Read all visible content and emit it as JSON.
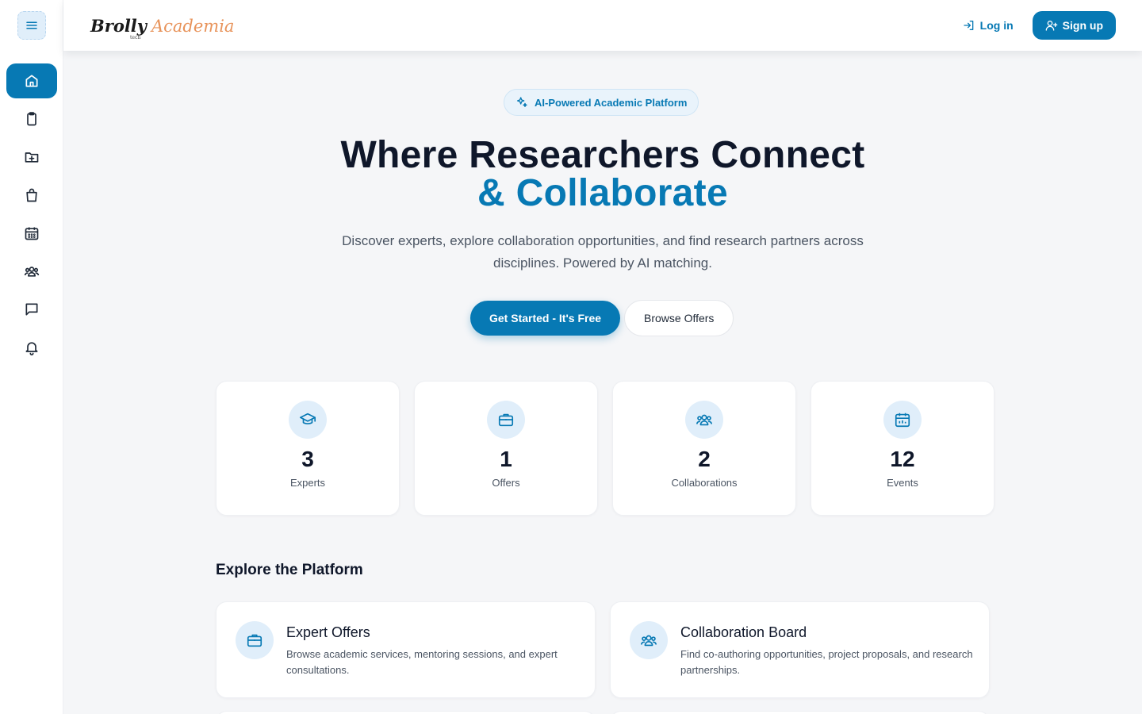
{
  "header": {
    "logo_word1": "Brolly",
    "logo_word2": "Academia",
    "logo_tm": "tech",
    "login_label": "Log in",
    "signup_label": "Sign up"
  },
  "sidebar": {
    "items": [
      {
        "icon": "home-icon",
        "active": true
      },
      {
        "icon": "clipboard-icon"
      },
      {
        "icon": "folder-plus-icon"
      },
      {
        "icon": "shopping-bag-icon"
      },
      {
        "icon": "calendar-icon"
      },
      {
        "icon": "users-icon"
      },
      {
        "icon": "message-icon"
      },
      {
        "icon": "bell-icon"
      }
    ]
  },
  "hero": {
    "badge": "AI-Powered Academic Platform",
    "title_line1": "Where Researchers Connect",
    "title_line2": "& Collaborate",
    "subtitle": "Discover experts, explore collaboration opportunities, and find research partners across disciplines. Powered by AI matching.",
    "cta_primary": "Get Started - It's Free",
    "cta_secondary": "Browse Offers"
  },
  "stats": [
    {
      "icon": "graduation-cap-icon",
      "value": "3",
      "label": "Experts"
    },
    {
      "icon": "briefcase-icon",
      "value": "1",
      "label": "Offers"
    },
    {
      "icon": "users-icon",
      "value": "2",
      "label": "Collaborations"
    },
    {
      "icon": "calendar-icon",
      "value": "12",
      "label": "Events"
    }
  ],
  "explore": {
    "title": "Explore the Platform",
    "cards": [
      {
        "icon": "briefcase-icon",
        "title": "Expert Offers",
        "desc": "Browse academic services, mentoring sessions, and expert consultations."
      },
      {
        "icon": "users-icon",
        "title": "Collaboration Board",
        "desc": "Find co-authoring opportunities, project proposals, and research partnerships."
      }
    ]
  },
  "colors": {
    "accent": "#0779b4",
    "accent_light": "#e0eefa",
    "logo_orange": "#e8935a"
  }
}
